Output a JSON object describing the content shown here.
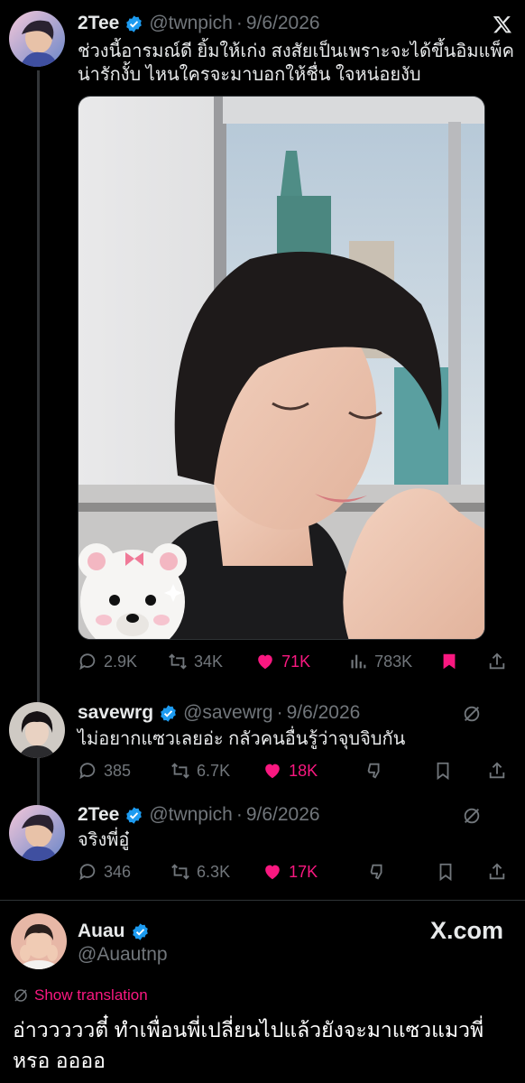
{
  "main_tweet": {
    "name": "2Tee",
    "handle": "@twnpich",
    "separator": "·",
    "date": "9/6/2026",
    "text_line1": "ช่วงนี้อารมณ์ดี ยิ้มให้เก่ง สงสัยเป็นเพราะจะได้ขึ้นอิมแพ็ค",
    "text_line2": "น่ารักงั้บ ไหนใครจะมาบอกให้ชื่น ใจหน่อยงับ",
    "replies": "2.9K",
    "reposts": "34K",
    "likes": "71K",
    "views": "783K"
  },
  "reply1": {
    "name": "savewrg",
    "handle": "@savewrg",
    "separator": "·",
    "date": "9/6/2026",
    "text": "ไม่อยากแซวเลยอ่ะ กลัวคนอื่นรู้ว่าจุบจิบกัน",
    "replies": "385",
    "reposts": "6.7K",
    "likes": "18K"
  },
  "reply2": {
    "name": "2Tee",
    "handle": "@twnpich",
    "separator": "·",
    "date": "9/6/2026",
    "text": "จริงพี่อู๋",
    "replies": "346",
    "reposts": "6.3K",
    "likes": "17K"
  },
  "quote_author": {
    "name": "Auau",
    "handle": "@Auautnp",
    "brand": "X.com"
  },
  "translation_label": "Show translation",
  "final_text": "อ่าวววววตี๋ ทำเพื่อนพี่เปลี่ยนไปแล้วยังจะมาแซวแมวพี่หรอ ออออ",
  "colors": {
    "background": "#000000",
    "text": "#e7e9ea",
    "muted": "#71767b",
    "like": "#f91880",
    "verified": "#1d9bf0"
  },
  "icons": [
    "verified-badge-icon",
    "x-logo-icon",
    "reply-icon",
    "repost-icon",
    "heart-icon",
    "views-icon",
    "bookmark-icon",
    "share-icon",
    "grok-icon",
    "dislike-icon",
    "translate-icon"
  ]
}
